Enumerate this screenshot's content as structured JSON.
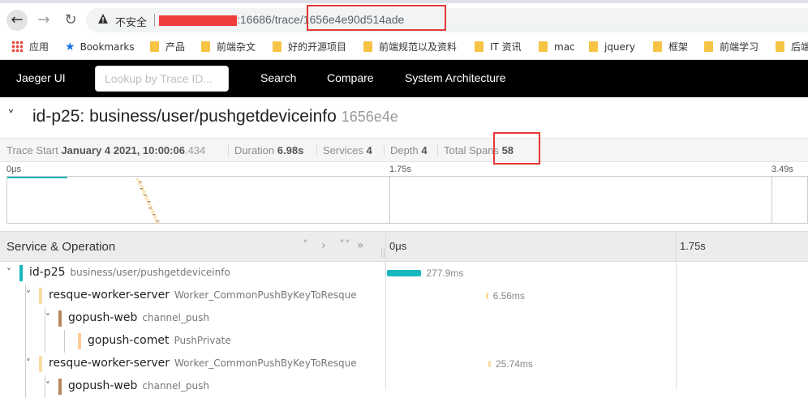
{
  "browser": {
    "insecure_label": "不安全",
    "url_suffix": ":16686/trace/",
    "trace_id": "1656e4e90d514ade",
    "bookmarks": [
      {
        "label": "应用",
        "icon": "apps-icon"
      },
      {
        "label": "Bookmarks",
        "icon": "star-icon"
      },
      {
        "label": "产品",
        "icon": "folder-icon"
      },
      {
        "label": "前端杂文",
        "icon": "folder-icon"
      },
      {
        "label": "好的开源项目",
        "icon": "folder-icon"
      },
      {
        "label": "前端规范以及资料",
        "icon": "folder-icon"
      },
      {
        "label": "IT 资讯",
        "icon": "folder-icon"
      },
      {
        "label": "mac",
        "icon": "folder-icon"
      },
      {
        "label": "jquery",
        "icon": "folder-icon"
      },
      {
        "label": "框架",
        "icon": "folder-icon"
      },
      {
        "label": "前端学习",
        "icon": "folder-icon"
      },
      {
        "label": "后端",
        "icon": "folder-icon"
      }
    ]
  },
  "jaeger": {
    "brand": "Jaeger UI",
    "lookup_placeholder": "Lookup by Trace ID...",
    "nav": [
      "Search",
      "Compare",
      "System Architecture"
    ]
  },
  "trace": {
    "service": "id-p25",
    "operation": "business/user/pushgetdeviceinfo",
    "short_id": "1656e4e",
    "summary": {
      "start_label": "Trace Start",
      "start_value": "January 4 2021, 10:00:06",
      "start_ms": ".434",
      "duration_label": "Duration",
      "duration_value": "6.98s",
      "services_label": "Services",
      "services_value": "4",
      "depth_label": "Depth",
      "depth_value": "4",
      "spans_label": "Total Spans",
      "spans_value": "58"
    },
    "minimap_ticks": [
      "0μs",
      "1.75s",
      "3.49s"
    ]
  },
  "timeline": {
    "header_title": "Service & Operation",
    "ticks": [
      "0μs",
      "1.75s"
    ],
    "colors": {
      "id-p25": "#17b8be",
      "resque-worker-server": "#f8dca1",
      "gopush-web": "#b7885e",
      "gopush-comet": "#ffcb99"
    },
    "rows": [
      {
        "service": "id-p25",
        "operation": "business/user/pushgetdeviceinfo",
        "duration": "277.9ms",
        "depth": 0,
        "expandable": true
      },
      {
        "service": "resque-worker-server",
        "operation": "Worker_CommonPushByKeyToResque",
        "duration": "6.56ms",
        "depth": 1,
        "expandable": true
      },
      {
        "service": "gopush-web",
        "operation": "channel_push",
        "duration": "",
        "depth": 2,
        "expandable": true
      },
      {
        "service": "gopush-comet",
        "operation": "PushPrivate",
        "duration": "",
        "depth": 3,
        "expandable": false
      },
      {
        "service": "resque-worker-server",
        "operation": "Worker_CommonPushByKeyToResque",
        "duration": "25.74ms",
        "depth": 1,
        "expandable": true
      },
      {
        "service": "gopush-web",
        "operation": "channel_push",
        "duration": "",
        "depth": 2,
        "expandable": true
      }
    ]
  }
}
